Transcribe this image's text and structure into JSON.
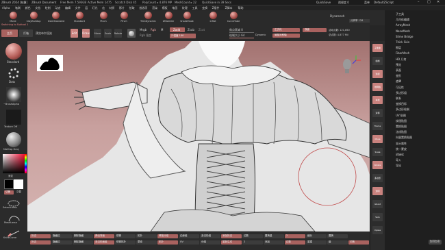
{
  "titlebar": {
    "app": "ZBrush 2024 [结算]",
    "document": "ZBrush Document",
    "free_mem": "Free Mem 7.593GB",
    "active_mem": "Active Mem 1475",
    "scratch_disk": "Scratch Disk 45",
    "poly_count": "PolyCount ▸ 4.876 MP",
    "mesh_count": "MeshCount ▸ 22",
    "quicksave": "QuickSave in 39 Secs",
    "quicksave_btn": "QuickSave",
    "see_through": "透视度 0",
    "menu_btn": "菜单",
    "default_script": "DefaultZScript"
  },
  "menubar": {
    "items": [
      "Alpha",
      "笔刷",
      "颜色",
      "文档",
      "绘制",
      "动态",
      "编辑",
      "文件",
      "层",
      "灯光",
      "宏",
      "材质",
      "影片",
      "拾取",
      "首选项",
      "渲染",
      "模板",
      "笔画",
      "纹理",
      "工具",
      "变换",
      "Z插件",
      "Z脚本",
      "帮助"
    ]
  },
  "brushes": [
    {
      "label": "Move"
    },
    {
      "label": "ClayBuildup"
    },
    {
      "label": "DamStandard"
    },
    {
      "label": "Standard"
    },
    {
      "label": "Pinch"
    },
    {
      "label": "Pinch"
    },
    {
      "label": "TrimDynamic"
    },
    {
      "label": "ZModeler"
    },
    {
      "label": "SnakeHook"
    },
    {
      "label": "Inflat"
    },
    {
      "label": "CurveTube"
    }
  ],
  "top_right": {
    "dynamesh": "Dynamesh",
    "resolution": "分辨率 128"
  },
  "switch_note": "Switching to Subtool 1",
  "row2": {
    "home": "主页",
    "lightbox": "灯箱",
    "live_boolean": "预览布尔渲染",
    "edit": "Edit",
    "draw": "Draw",
    "move": "Move",
    "scale": "Scale",
    "rotate": "Rotate",
    "mrgb": "Mrgb",
    "rgb": "Rgb",
    "m": "M",
    "zadd": "Zadd",
    "zsub": "Zsub",
    "zcut": "Zcut",
    "rgb_intensity": "Rgb 强度",
    "z_intensity": "Z 强度 100",
    "focal_shift": "焦点衰减 0",
    "draw_size": "绘制大小 64",
    "dynamic": "Dynamic",
    "active_points": "活动点数: 121,850",
    "total_points": "总点数: 4.877 Mil",
    "ortho": "正交化",
    "local_symmetry": "局部对称轴",
    "double": "双面",
    "transp": "透明",
    "ghost": "Ghost"
  },
  "left": {
    "brush_name": "Standard",
    "stroke": "Dots",
    "alpha": "~BrushAlpha",
    "texture": "Texture Off",
    "material": "MatCap Gray",
    "gradient": "渐变",
    "switch_color": "切换",
    "alternate": "交替",
    "select_lasso": "SelectLasso",
    "mask_lasso": "MaskLasso",
    "knife": "KnifeCurve"
  },
  "right_shelf": [
    {
      "label": "子像素"
    },
    {
      "label": "绘制"
    },
    {
      "label": "透视"
    },
    {
      "label": "地网格"
    },
    {
      "label": "本地"
    },
    {
      "label": "对称"
    },
    {
      "label": "Frame"
    },
    {
      "label": "Move"
    },
    {
      "label": "Scale"
    },
    {
      "label": "Rotate"
    },
    {
      "label": "多边形"
    },
    {
      "label": "透明"
    },
    {
      "label": "Ghost"
    },
    {
      "label": "Solo"
    },
    {
      "label": "Xpose"
    }
  ],
  "tray": {
    "items": [
      "子工具",
      "几何体编辑",
      "ArrayMesh",
      "NanoMesh",
      "Slime Bridge",
      "Thick Skin",
      "图层",
      "FiberMesh",
      "HD 几何",
      "预览",
      "表面",
      "变形",
      "遮罩",
      "可见性",
      "多边形组",
      "联系",
      "变换目标",
      "多边形绘制",
      "UV 贴图",
      "纹理贴图",
      "置换贴图",
      "法线贴图",
      "向量置换贴图",
      "显示属性",
      "统一蒙皮",
      "初始化",
      "导入",
      "导出"
    ]
  },
  "bottom": {
    "row1": [
      "折边",
      "隐藏边",
      "删除隐藏",
      "弹出背面",
      "镜像",
      "拓扑",
      "焊接分组",
      "边缘组",
      "多边形组",
      "添加折边",
      "边数",
      "置换量",
      "2",
      "细分",
      "置换"
    ],
    "row2": [
      "折边",
      "隐藏边",
      "删除隐藏",
      "多边形面组",
      "镜像拓扑",
      "蒙皮",
      "拓扑",
      "UV",
      "分组",
      "重新生成",
      "2",
      "添加",
      "边数",
      "重建",
      "级",
      "切换"
    ],
    "undo": "撤销",
    "subdivide": "细分级"
  },
  "watermark": "bilibili"
}
